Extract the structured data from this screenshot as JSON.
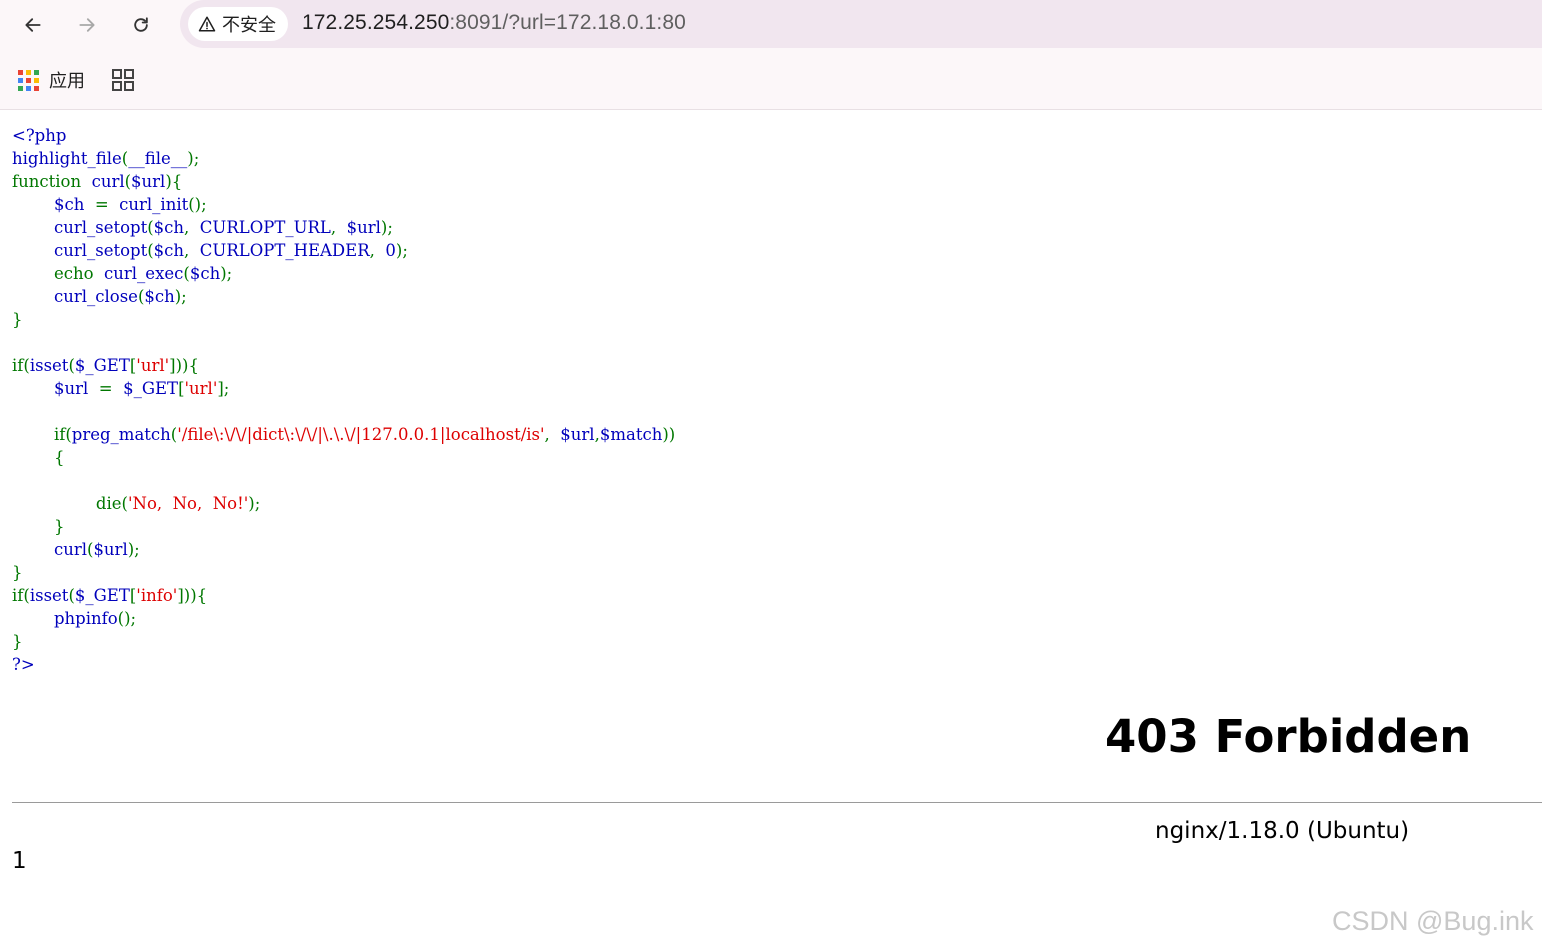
{
  "browser": {
    "security_label": "不安全",
    "url_host": "172.25.254.250",
    "url_rest": ":8091/?url=172.18.0.1:80"
  },
  "bookmarks": {
    "apps_label": "应用"
  },
  "code_lines": [
    [
      {
        "c": "kw-b",
        "t": "<?php"
      }
    ],
    [
      {
        "c": "kw-b",
        "t": "highlight_file"
      },
      {
        "c": "kw-d",
        "t": "("
      },
      {
        "c": "kw-b",
        "t": "__file__"
      },
      {
        "c": "kw-d",
        "t": ");"
      }
    ],
    [
      {
        "c": "kw-d",
        "t": "function "
      },
      {
        "c": "kw-b",
        "t": " curl"
      },
      {
        "c": "kw-d",
        "t": "("
      },
      {
        "c": "kw-b",
        "t": "$url"
      },
      {
        "c": "kw-d",
        "t": "){"
      }
    ],
    [
      {
        "c": "kw-b",
        "t": "        $ch "
      },
      {
        "c": "kw-d",
        "t": " = "
      },
      {
        "c": "kw-b",
        "t": " curl_init"
      },
      {
        "c": "kw-d",
        "t": "();"
      }
    ],
    [
      {
        "c": "kw-b",
        "t": "        curl_setopt"
      },
      {
        "c": "kw-d",
        "t": "("
      },
      {
        "c": "kw-b",
        "t": "$ch"
      },
      {
        "c": "kw-d",
        "t": ", "
      },
      {
        "c": "kw-b",
        "t": " CURLOPT_URL"
      },
      {
        "c": "kw-d",
        "t": ", "
      },
      {
        "c": "kw-b",
        "t": " $url"
      },
      {
        "c": "kw-d",
        "t": ");"
      }
    ],
    [
      {
        "c": "kw-b",
        "t": "        curl_setopt"
      },
      {
        "c": "kw-d",
        "t": "("
      },
      {
        "c": "kw-b",
        "t": "$ch"
      },
      {
        "c": "kw-d",
        "t": ", "
      },
      {
        "c": "kw-b",
        "t": " CURLOPT_HEADER"
      },
      {
        "c": "kw-d",
        "t": ", "
      },
      {
        "c": "kw-b",
        "t": " 0"
      },
      {
        "c": "kw-d",
        "t": ");"
      }
    ],
    [
      {
        "c": "kw-d",
        "t": "        echo "
      },
      {
        "c": "kw-b",
        "t": " curl_exec"
      },
      {
        "c": "kw-d",
        "t": "("
      },
      {
        "c": "kw-b",
        "t": "$ch"
      },
      {
        "c": "kw-d",
        "t": ");"
      }
    ],
    [
      {
        "c": "kw-b",
        "t": "        curl_close"
      },
      {
        "c": "kw-d",
        "t": "("
      },
      {
        "c": "kw-b",
        "t": "$ch"
      },
      {
        "c": "kw-d",
        "t": ");"
      }
    ],
    [
      {
        "c": "kw-d",
        "t": "}"
      }
    ],
    [
      {
        "c": "kw-d",
        "t": ""
      }
    ],
    [
      {
        "c": "kw-d",
        "t": "if("
      },
      {
        "c": "kw-b",
        "t": "isset"
      },
      {
        "c": "kw-d",
        "t": "("
      },
      {
        "c": "kw-b",
        "t": "$_GET"
      },
      {
        "c": "kw-d",
        "t": "["
      },
      {
        "c": "kw-s",
        "t": "'url'"
      },
      {
        "c": "kw-d",
        "t": "])){"
      }
    ],
    [
      {
        "c": "kw-b",
        "t": "        $url "
      },
      {
        "c": "kw-d",
        "t": " = "
      },
      {
        "c": "kw-b",
        "t": " $_GET"
      },
      {
        "c": "kw-d",
        "t": "["
      },
      {
        "c": "kw-s",
        "t": "'url'"
      },
      {
        "c": "kw-d",
        "t": "];"
      }
    ],
    [
      {
        "c": "kw-d",
        "t": ""
      }
    ],
    [
      {
        "c": "kw-d",
        "t": "        if("
      },
      {
        "c": "kw-b",
        "t": "preg_match"
      },
      {
        "c": "kw-d",
        "t": "("
      },
      {
        "c": "kw-s",
        "t": "'/file\\:\\/\\/|dict\\:\\/\\/|\\.\\.\\/|127.0.0.1|localhost/is'"
      },
      {
        "c": "kw-d",
        "t": ", "
      },
      {
        "c": "kw-b",
        "t": " $url"
      },
      {
        "c": "kw-d",
        "t": ","
      },
      {
        "c": "kw-b",
        "t": "$match"
      },
      {
        "c": "kw-d",
        "t": "))"
      }
    ],
    [
      {
        "c": "kw-d",
        "t": "        {"
      }
    ],
    [
      {
        "c": "kw-d",
        "t": ""
      }
    ],
    [
      {
        "c": "kw-d",
        "t": "                die("
      },
      {
        "c": "kw-s",
        "t": "'No, "
      },
      {
        "c": "kw-s",
        "t": " No, "
      },
      {
        "c": "kw-s",
        "t": " No!'"
      },
      {
        "c": "kw-d",
        "t": ");"
      }
    ],
    [
      {
        "c": "kw-d",
        "t": "        }"
      }
    ],
    [
      {
        "c": "kw-b",
        "t": "        curl"
      },
      {
        "c": "kw-d",
        "t": "("
      },
      {
        "c": "kw-b",
        "t": "$url"
      },
      {
        "c": "kw-d",
        "t": ");"
      }
    ],
    [
      {
        "c": "kw-d",
        "t": "}"
      }
    ],
    [
      {
        "c": "kw-d",
        "t": "if("
      },
      {
        "c": "kw-b",
        "t": "isset"
      },
      {
        "c": "kw-d",
        "t": "("
      },
      {
        "c": "kw-b",
        "t": "$_GET"
      },
      {
        "c": "kw-d",
        "t": "["
      },
      {
        "c": "kw-s",
        "t": "'info'"
      },
      {
        "c": "kw-d",
        "t": "])){"
      }
    ],
    [
      {
        "c": "kw-b",
        "t": "        phpinfo"
      },
      {
        "c": "kw-d",
        "t": "();"
      }
    ],
    [
      {
        "c": "kw-d",
        "t": "}"
      }
    ],
    [
      {
        "c": "kw-b",
        "t": "?>"
      }
    ]
  ],
  "response": {
    "title": "403 Forbidden",
    "server_signature": "nginx/1.18.0 (Ubuntu)",
    "output": "1"
  },
  "watermark": "CSDN @Bug.ink",
  "colors": {
    "php_default": "#0000bb",
    "php_keyword": "#007700",
    "php_string": "#dd0000"
  }
}
